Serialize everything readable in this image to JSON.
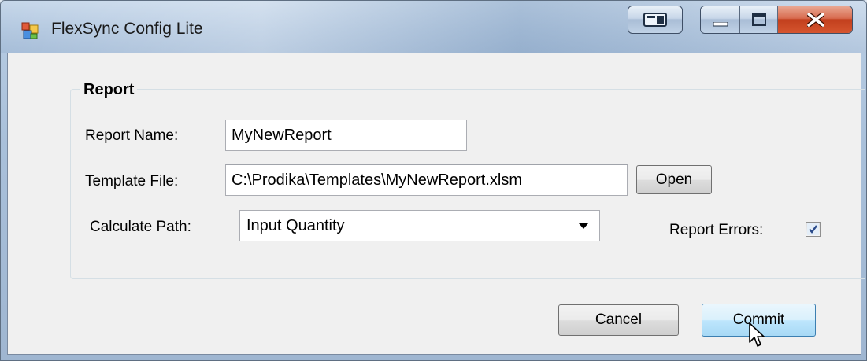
{
  "window": {
    "title": "FlexSync Config Lite"
  },
  "report_group": {
    "legend": "Report",
    "report_name": {
      "label": "Report Name:",
      "value": "MyNewReport"
    },
    "template_file": {
      "label": "Template File:",
      "value": "C:\\Prodika\\Templates\\MyNewReport.xlsm",
      "open_label": "Open"
    },
    "calculate_path": {
      "label": "Calculate Path:",
      "selected": "Input Quantity"
    },
    "report_errors": {
      "label": "Report Errors:",
      "checked": true
    }
  },
  "footer": {
    "cancel_label": "Cancel",
    "commit_label": "Commit"
  },
  "icons": {
    "app": "window-app-icon",
    "restore": "switch-window-icon",
    "minimize": "minimize-icon",
    "maximize": "maximize-icon",
    "close": "close-icon",
    "dropdown": "chevron-down-icon",
    "check": "checkmark-icon",
    "cursor": "mouse-pointer-icon"
  },
  "colors": {
    "close_button": "#c23f1d",
    "client_bg": "#f0f0f0",
    "focused_button_border": "#3c7fb1"
  }
}
